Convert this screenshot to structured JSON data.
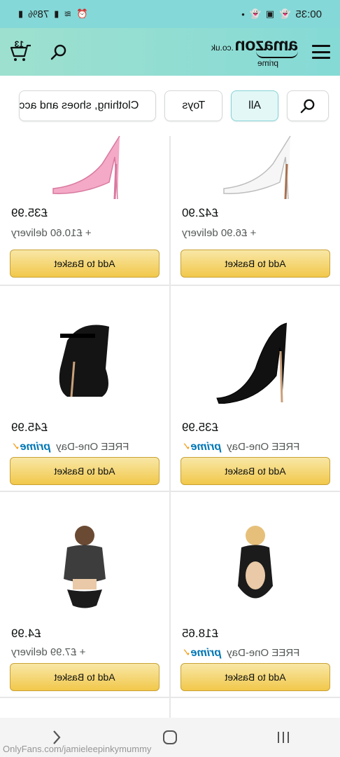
{
  "status_bar": {
    "time": "00:35",
    "battery": "78%"
  },
  "header": {
    "logo_main": "amazon",
    "logo_tld": ".co.uk",
    "logo_sub": "prime",
    "cart_count": "13"
  },
  "chips": [
    {
      "label": "All",
      "active": true
    },
    {
      "label": "Toys",
      "active": false
    },
    {
      "label": "Clothing, shoes and acc",
      "active": false
    }
  ],
  "products": [
    {
      "price": "£42.90",
      "delivery": "+ £6.90 delivery",
      "prime": false,
      "button": "Add to Basket",
      "image": "white-stiletto-heel"
    },
    {
      "price": "£35.99",
      "delivery": "+ £10.60 delivery",
      "prime": false,
      "button": "Add to Basket",
      "image": "pink-stiletto-heel"
    },
    {
      "price": "£35.99",
      "delivery": "FREE One-Day",
      "prime": true,
      "button": "Add to Basket",
      "image": "black-stiletto-heel"
    },
    {
      "price": "£45.99",
      "delivery": "FREE One-Day",
      "prime": true,
      "button": "Add to Basket",
      "image": "black-platform-sandal"
    },
    {
      "price": "£18.65",
      "delivery": "FREE One-Day",
      "prime": true,
      "button": "Add to Basket",
      "image": "black-lingerie-bodysuit"
    },
    {
      "price": "£4.99",
      "delivery": "+ £7.99 delivery",
      "prime": false,
      "button": "Add to Basket",
      "image": "black-lingerie-set"
    }
  ],
  "prime_label": "prime",
  "watermark": "OnlyFans.com/jamieleepinkymummy",
  "colors": {
    "header": "#85dad6",
    "button": "#f2c84b",
    "prime": "#0077b6"
  }
}
